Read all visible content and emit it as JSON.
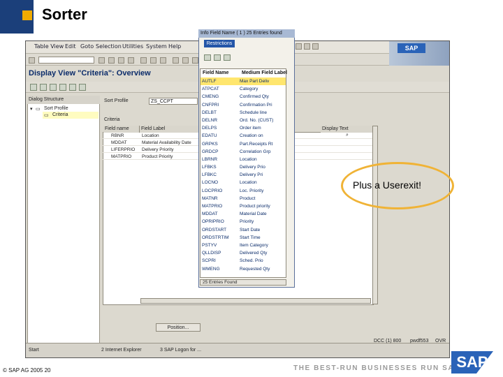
{
  "slide": {
    "title": "Sorter",
    "copyright": "© SAP AG 2005 20",
    "tagline": "THE BEST-RUN BUSINESSES RUN SAP",
    "logo": "SAP",
    "callout": "Plus a Userexit!",
    "accent_color": "#f0ab00",
    "brand_color": "#1b3f7a"
  },
  "window": {
    "menu": [
      "Table View",
      "Edit",
      "Goto",
      "Selection",
      "Utilities",
      "System",
      "Help"
    ],
    "view_title": "Display View \"Criteria\": Overview",
    "logo": "SAP"
  },
  "tree": {
    "header": "Dialog Structure",
    "items": [
      "Sort Profile",
      "Criteria"
    ]
  },
  "form": {
    "profile_label": "Sort Profile",
    "profile_value": "ZS_CCPT",
    "criteria_label": "Criteria",
    "columns": [
      "Field name",
      "Field Label",
      "Display Text"
    ],
    "rows": [
      {
        "field": "RBNR",
        "label": "Location"
      },
      {
        "field": "MDDAT",
        "label": "Material Availability Date"
      },
      {
        "field": "LIFERPRIO",
        "label": "Delivery Priority"
      },
      {
        "field": "MATPRIO",
        "label": "Product Priority"
      }
    ],
    "position_button": "Position..."
  },
  "popup": {
    "title": "Info Field Name ( 1 ) 25 Entries found",
    "restrictions_tab": "Restrictions",
    "columns": [
      "Field Name",
      "Medium Field Label"
    ],
    "rows": [
      {
        "name": "AUTLF",
        "label": "Max Part Deliv"
      },
      {
        "name": "ATPCAT",
        "label": "Category"
      },
      {
        "name": "CMENG",
        "label": "Confirmed Qty"
      },
      {
        "name": "CNFPRI",
        "label": "Confirmation Pri"
      },
      {
        "name": "DELBT",
        "label": "Schedule line"
      },
      {
        "name": "DELNR",
        "label": "Ord. No. (CUST)"
      },
      {
        "name": "DELPS",
        "label": "Order item"
      },
      {
        "name": "EDATU",
        "label": "Creation on"
      },
      {
        "name": "GRPKS",
        "label": "Part.Receipts Rt"
      },
      {
        "name": "GRDCP",
        "label": "Correlation Grp"
      },
      {
        "name": "LBRNR",
        "label": "Location"
      },
      {
        "name": "LFBKS",
        "label": "Delivery Prio"
      },
      {
        "name": "LFBKC",
        "label": "Delivery Pri"
      },
      {
        "name": "LOCNO",
        "label": "Location"
      },
      {
        "name": "LOCPRIO",
        "label": "Loc. Priority"
      },
      {
        "name": "MATNR",
        "label": "Product"
      },
      {
        "name": "MATPRIO",
        "label": "Product priority"
      },
      {
        "name": "MDDAT",
        "label": "Material Date"
      },
      {
        "name": "OPRIPRIO",
        "label": "Priority"
      },
      {
        "name": "ORDSTART",
        "label": "Start Date"
      },
      {
        "name": "ORDSTRTIM",
        "label": "Start Time"
      },
      {
        "name": "PSTYV",
        "label": "Item Category"
      },
      {
        "name": "QLLDISP",
        "label": "Delivered Qty"
      },
      {
        "name": "SCPRI",
        "label": "Sched. Prio"
      },
      {
        "name": "WMENG",
        "label": "Requested Qty"
      }
    ],
    "status": "25 Entries Found"
  },
  "statusbar": {
    "system": "DCC (1) 800",
    "server": "pwdf553",
    "mode": "OVR"
  },
  "taskbar": {
    "start": "Start",
    "task1": "2 Internet Explorer",
    "task2": "3 SAP Logon for ..."
  }
}
